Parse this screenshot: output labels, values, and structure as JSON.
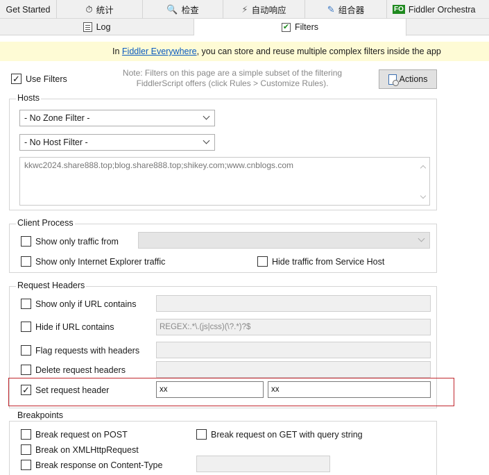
{
  "tabs_top": [
    {
      "label": "Get Started",
      "icon": ""
    },
    {
      "label": "统计",
      "icon": "stopwatch-icon"
    },
    {
      "label": "检查",
      "icon": "magnifier-icon"
    },
    {
      "label": "自动响应",
      "icon": "lightning-icon"
    },
    {
      "label": "组合器",
      "icon": "pencil-icon"
    },
    {
      "label": "Fiddler Orchestra",
      "icon": "fo-badge-icon",
      "badge": "FO"
    }
  ],
  "tabs_second": [
    {
      "label": "Log",
      "icon": "log-icon"
    },
    {
      "label": "Filters",
      "icon": "check-icon"
    }
  ],
  "banner": {
    "prefix": "In ",
    "link": "Fiddler Everywhere",
    "suffix": ", you can store and reuse multiple complex filters inside the app"
  },
  "top": {
    "use_filters": {
      "label": "Use Filters",
      "checked": true
    },
    "note_line1": "Note: Filters on this page are a simple subset of the filtering",
    "note_line2": "FiddlerScript offers (click Rules > Customize Rules).",
    "actions_label": "Actions"
  },
  "hosts": {
    "title": "Hosts",
    "zone_filter": "- No Zone Filter -",
    "host_filter": "- No Host Filter -",
    "host_list": "kkwc2024.share888.top;blog.share888.top;shikey.com;www.cnblogs.com"
  },
  "client_process": {
    "title": "Client Process",
    "show_only_traffic_from": {
      "label": "Show only traffic from",
      "checked": false
    },
    "show_only_ie": {
      "label": "Show only Internet Explorer traffic",
      "checked": false
    },
    "hide_service_host": {
      "label": "Hide traffic from Service Host",
      "checked": false
    }
  },
  "request_headers": {
    "title": "Request Headers",
    "show_if_url": {
      "label": "Show only if URL contains",
      "checked": false,
      "value": ""
    },
    "hide_if_url": {
      "label": "Hide if URL contains",
      "checked": false,
      "value": "REGEX:.*\\.(js|css)(\\?.*)?$"
    },
    "flag_requests": {
      "label": "Flag requests with headers",
      "checked": false,
      "value": ""
    },
    "delete_headers": {
      "label": "Delete request headers",
      "checked": false,
      "value": ""
    },
    "set_header": {
      "label": "Set request header",
      "checked": true,
      "name": "xx",
      "value": "xx"
    }
  },
  "breakpoints": {
    "title": "Breakpoints",
    "post": {
      "label": "Break request on POST",
      "checked": false
    },
    "get_query": {
      "label": "Break request on GET with query string",
      "checked": false
    },
    "xhr": {
      "label": "Break on XMLHttpRequest",
      "checked": false
    },
    "content_type": {
      "label": "Break response on Content-Type",
      "checked": false,
      "value": ""
    }
  },
  "colors": {
    "highlight": "#c0262d",
    "banner_bg": "#fefbd5",
    "link": "#0b5bbf"
  }
}
